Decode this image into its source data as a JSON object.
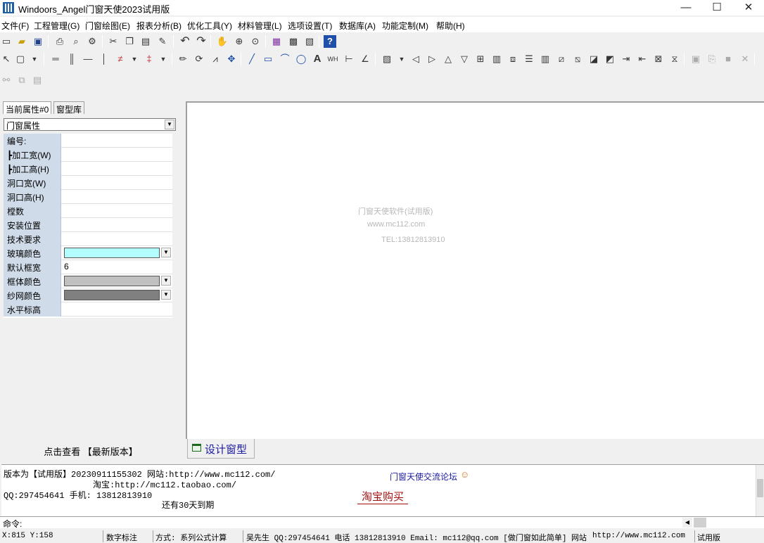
{
  "window": {
    "title": "Windoors_Angel门窗天使2023试用版",
    "minimize": "—",
    "maximize": "☐",
    "close": "✕"
  },
  "menu": [
    "文件(F)",
    "工程管理(G)",
    "门窗绘图(E)",
    "报表分析(B)",
    "优化工具(Y)",
    "材料管理(L)",
    "选项设置(T)",
    "数据库(A)",
    "功能定制(M)",
    "帮助(H)"
  ],
  "left_panel": {
    "tabs": [
      "当前属性#0",
      "窗型库"
    ],
    "combo_value": "门窗属性",
    "properties": [
      {
        "label": "编号:",
        "value": ""
      },
      {
        "label": "┣加工宽(W)",
        "value": ""
      },
      {
        "label": "┣加工高(H)",
        "value": ""
      },
      {
        "label": "洞口宽(W)",
        "value": ""
      },
      {
        "label": "洞口高(H)",
        "value": ""
      },
      {
        "label": "樘数",
        "value": ""
      },
      {
        "label": "安装位置",
        "value": ""
      },
      {
        "label": "技术要求",
        "value": ""
      },
      {
        "label": "玻璃颜色",
        "value": ""
      },
      {
        "label": "默认框宽",
        "value": "6"
      },
      {
        "label": "框体颜色",
        "value": ""
      },
      {
        "label": "纱网颜色",
        "value": ""
      },
      {
        "label": "水平标高",
        "value": ""
      }
    ],
    "colors": {
      "glass": "#b3ffff",
      "frame": "#c0c0c0",
      "screen": "#808080"
    },
    "latest_link": "点击查看 【最新版本】"
  },
  "canvas": {
    "watermark_1": "门窗天使软件(试用版)",
    "watermark_2": "www.mc112.com",
    "watermark_3": "TEL:13812813910",
    "design_tab": "设计窗型"
  },
  "info": {
    "line1": "版本为【试用版】20230911155302  网站:http://www.mc112.com/",
    "line2": "淘宝:http://mc112.taobao.com/",
    "line3": "QQ:297454641 手机: 13812813910",
    "line4": "还有30天到期",
    "forum": "门窗天使交流论坛",
    "buy": "淘宝购买"
  },
  "command": {
    "label": "命令:"
  },
  "status": {
    "coords": "X:815  Y:158",
    "mode": "数字标注",
    "method": "方式: 系列公式计算",
    "contact": "吴先生 QQ:297454641 电话 13812813910 Email: mc112@qq.com [做门窗如此简单]  网站",
    "url": "http://www.mc112.com",
    "edition": "试用版"
  }
}
